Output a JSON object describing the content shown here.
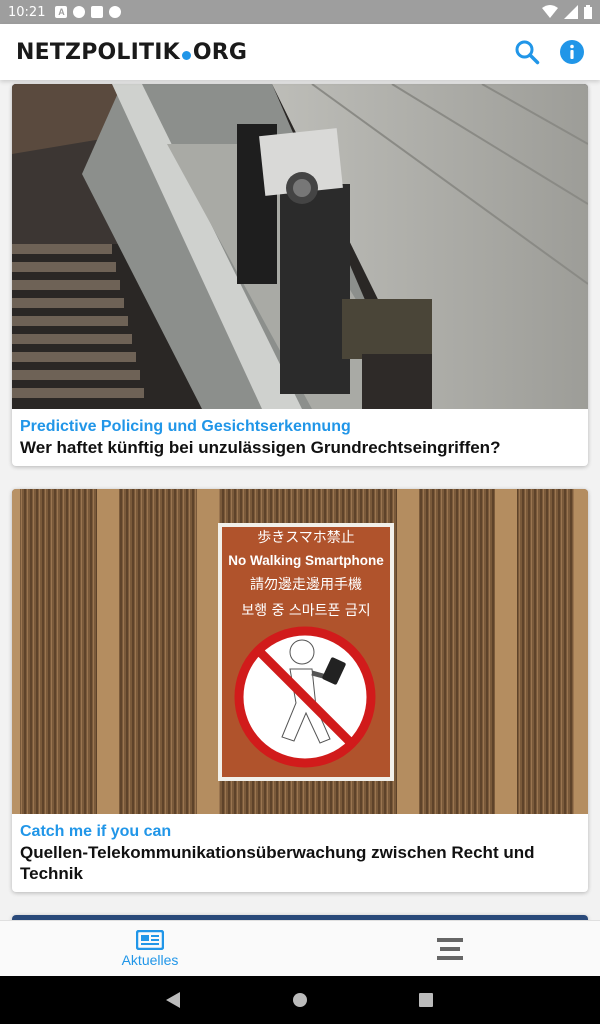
{
  "status_bar": {
    "time": "10:21",
    "notif_icons": [
      "A"
    ]
  },
  "app_bar": {
    "logo_left": "NETZPOLITIK",
    "logo_right": "ORG",
    "search_icon": "search-icon",
    "info_icon": "info-icon",
    "accent": "#2196e8"
  },
  "articles": [
    {
      "kicker": "Predictive Policing und Gesichtserkennung",
      "title": "Wer haftet künftig bei unzulässigen Grundrechtseingriffen?"
    },
    {
      "kicker": "Catch me if you can",
      "title": "Quellen-Telekommunikationsüberwachung zwischen Recht und Technik",
      "sign": {
        "line1": "歩きスマホ禁止",
        "line2": "No Walking Smartphone",
        "line3": "請勿邊走邊用手機",
        "line4": "보행 중 스마트폰 금지"
      }
    }
  ],
  "bottom_nav": {
    "items": [
      {
        "label": "Aktuelles",
        "icon": "newspaper-icon",
        "active": true
      },
      {
        "label": "",
        "icon": "menu-icon",
        "active": false
      }
    ]
  }
}
